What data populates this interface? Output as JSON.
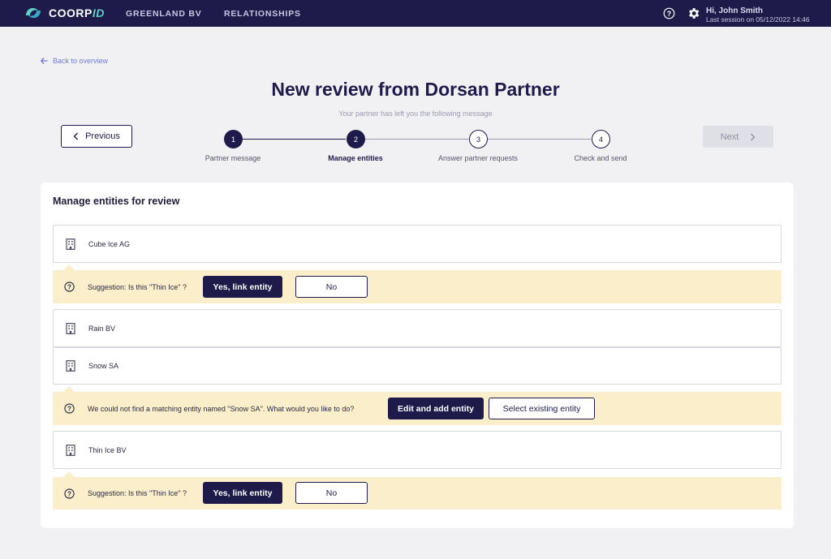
{
  "topbar": {
    "brand_main": "COORP",
    "brand_accent": "ID",
    "nav": [
      "GREENLAND BV",
      "RELATIONSHIPS"
    ],
    "user_greeting": "Hi, John Smith",
    "last_session": "Last session on  05/12/2022 14:46"
  },
  "header": {
    "back_label": "Back to overview",
    "title": "New review from Dorsan Partner",
    "subtitle": "Your partner has left you the following message",
    "previous_label": "Previous",
    "next_label": "Next"
  },
  "stepper": {
    "current_step": 2,
    "steps": [
      {
        "number": "1",
        "label": "Partner message"
      },
      {
        "number": "2",
        "label": "Manage entities"
      },
      {
        "number": "3",
        "label": "Answer partner requests"
      },
      {
        "number": "4",
        "label": "Check and send"
      }
    ]
  },
  "card": {
    "title": "Manage entities for review",
    "entities": [
      {
        "name": "Cube Ice AG"
      },
      {
        "name": "Rain BV"
      },
      {
        "name": "Snow SA"
      },
      {
        "name": "Thin Ice BV"
      }
    ],
    "suggestions": [
      {
        "message": "Suggestion: Is this \"Thin Ice\" ?",
        "primary": "Yes, link entity",
        "secondary": "No"
      },
      {
        "message": "We could not find a matching entity named \"Snow SA\". What would you like to do?",
        "primary": "Edit and add entity",
        "secondary": "Select existing entity"
      },
      {
        "message": "Suggestion: Is this \"Thin Ice\" ?",
        "primary": "Yes, link entity",
        "secondary": "No"
      }
    ]
  },
  "colors": {
    "brand_navy": "#1e1b4b",
    "brand_teal": "#5fd0c8",
    "suggestion_bg": "#fbefcb",
    "link_blue": "#6f7bd6"
  },
  "icons": [
    "coorpid-logo-icon",
    "help-icon",
    "gear-icon",
    "back-arrow-icon",
    "chevron-left-icon",
    "chevron-right-icon",
    "building-icon",
    "question-circle-icon"
  ]
}
